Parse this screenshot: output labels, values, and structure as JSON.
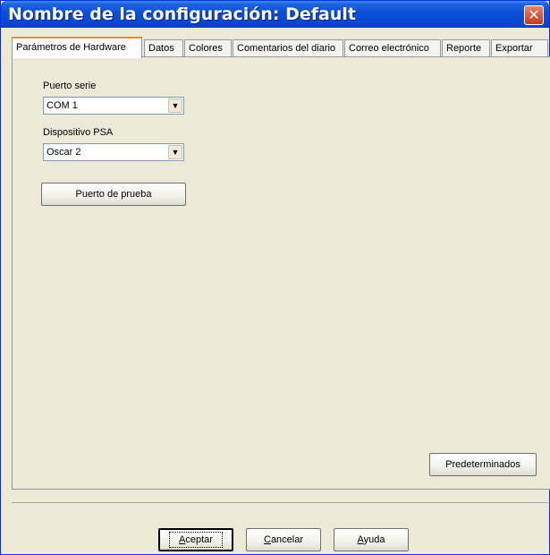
{
  "window": {
    "title": "Nombre de la configuración: Default",
    "close_glyph": "✕"
  },
  "tabs": [
    {
      "label": "Parámetros de Hardware",
      "active": true
    },
    {
      "label": "Datos",
      "active": false
    },
    {
      "label": "Colores",
      "active": false
    },
    {
      "label": "Comentarios del diario",
      "active": false
    },
    {
      "label": "Correo electrónico",
      "active": false
    },
    {
      "label": "Reporte",
      "active": false
    },
    {
      "label": "Exportar",
      "active": false
    }
  ],
  "hardware": {
    "serial_port_label": "Puerto serie",
    "serial_port_value": "COM 1",
    "psa_device_label": "Dispositivo PSA",
    "psa_device_value": "Oscar 2",
    "test_port_button": "Puerto de prueba",
    "defaults_button": "Predeterminados",
    "dropdown_arrow": "▼"
  },
  "footer": {
    "accept_first": "A",
    "accept_rest": "ceptar",
    "cancel_first": "C",
    "cancel_rest": "ancelar",
    "help_first": "A",
    "help_rest": "yuda"
  }
}
